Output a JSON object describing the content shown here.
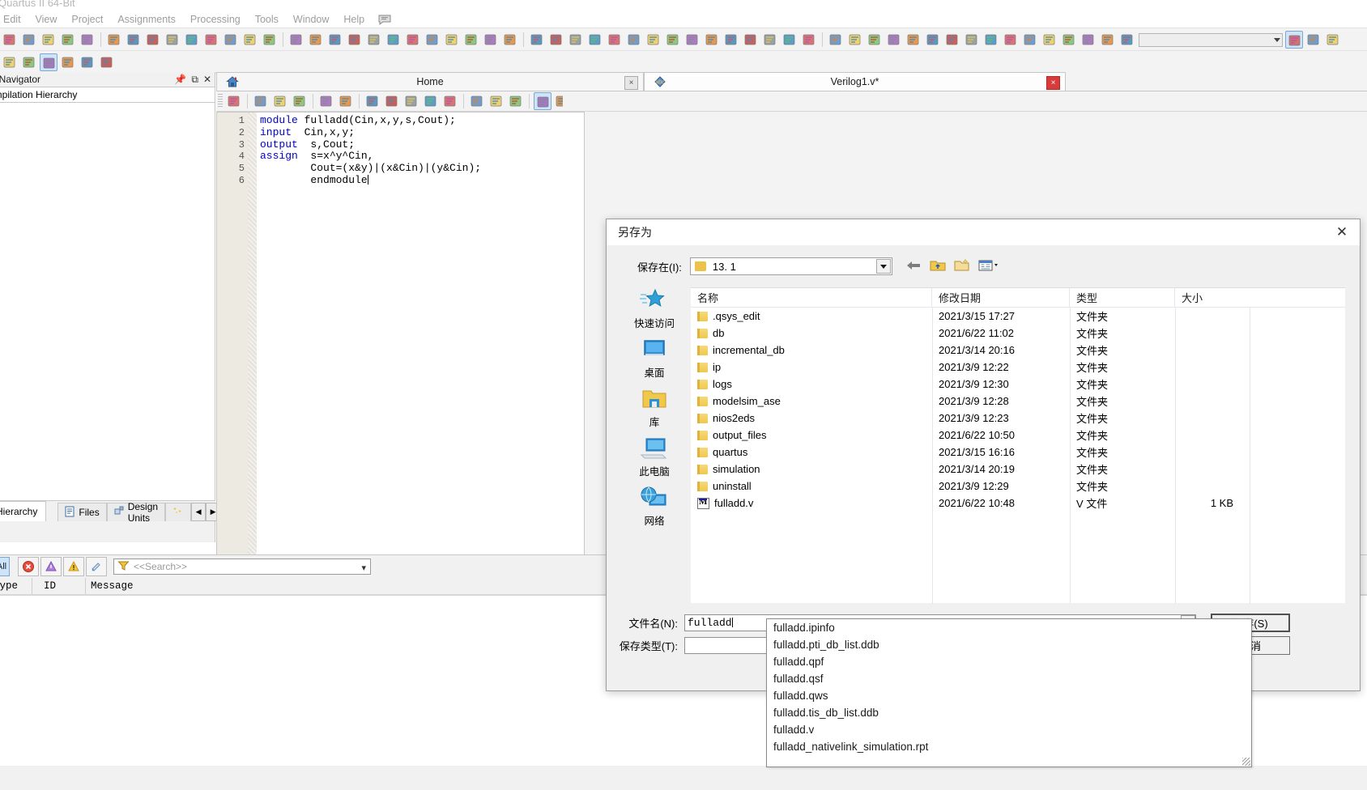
{
  "app": {
    "title": "Quartus II 64-Bit",
    "menu": [
      "Edit",
      "View",
      "Project",
      "Assignments",
      "Processing",
      "Tools",
      "Window",
      "Help"
    ],
    "menu_icon": "comment-balloon-icon"
  },
  "toolbar": {
    "combo_value": "",
    "combo_placeholder": ""
  },
  "navigator": {
    "title": "Project Navigator",
    "title_truncated": "ct Navigator",
    "subtitle": "Compilation Hierarchy",
    "subtitle_truncated": "ompilation Hierarchy",
    "pin_icon": "pin-icon",
    "restore_icon": "restore-icon",
    "close_icon": "close-icon",
    "tabs": [
      {
        "label": "Hierarchy",
        "label_truncated": "Hierarchy",
        "icon": "hierarchy-icon",
        "active": true
      },
      {
        "label": "Files",
        "icon": "files-icon",
        "active": false
      },
      {
        "label": "Design Units",
        "icon": "design-units-icon",
        "active": false
      },
      {
        "label": "",
        "icon": "ip-components-icon",
        "active": false
      }
    ],
    "scroll_left": "◀",
    "scroll_right": "▶"
  },
  "editor": {
    "tabs": [
      {
        "label": "Home",
        "icon": "home-icon",
        "close": "×",
        "active": false
      },
      {
        "label": "Verilog1.v*",
        "icon": "abc-diamond-icon",
        "close": "×",
        "active": true
      }
    ],
    "line_numbers": [
      "1",
      "2",
      "3",
      "4",
      "5",
      "6"
    ],
    "code_lines": [
      {
        "indent": 0,
        "keyword": "module",
        "rest": " fulladd(Cin,x,y,s,Cout);"
      },
      {
        "indent": 0,
        "keyword": "input",
        "rest": "  Cin,x,y;"
      },
      {
        "indent": 0,
        "keyword": "output",
        "rest": "  s,Cout;"
      },
      {
        "indent": 0,
        "keyword": "assign",
        "rest": "  s=x^y^Cin,"
      },
      {
        "indent": 8,
        "keyword": "",
        "rest": "Cout=(x&y)|(x&Cin)|(y&Cin);"
      },
      {
        "indent": 8,
        "keyword": "",
        "rest": "endmodule",
        "caret": true
      }
    ]
  },
  "messages": {
    "buttons": [
      {
        "label": "All",
        "name": "filter-all-button"
      },
      {
        "label": "",
        "name": "error-filter-button"
      },
      {
        "label": "",
        "name": "critical-warning-filter-button"
      },
      {
        "label": "",
        "name": "warning-filter-button"
      },
      {
        "label": "",
        "name": "info-filter-button"
      }
    ],
    "search_placeholder": "<<Search>>",
    "columns": [
      "Type",
      "ID",
      "Message"
    ],
    "rows": []
  },
  "dialog": {
    "title": "另存为",
    "close_label": "✕",
    "save_in_label": "保存在(I):",
    "current_folder": "13. 1",
    "nav_icons": [
      {
        "name": "back-arrow-icon",
        "glyph": "←"
      },
      {
        "name": "up-folder-icon",
        "glyph": ""
      },
      {
        "name": "new-folder-icon",
        "glyph": ""
      },
      {
        "name": "view-mode-icon",
        "glyph": ""
      }
    ],
    "places": [
      {
        "label": "快速访问",
        "icon": "quick-access-star-icon"
      },
      {
        "label": "桌面",
        "icon": "desktop-icon"
      },
      {
        "label": "库",
        "icon": "library-folder-icon"
      },
      {
        "label": "此电脑",
        "icon": "this-pc-icon"
      },
      {
        "label": "网络",
        "icon": "network-icon"
      }
    ],
    "columns": [
      "名称",
      "修改日期",
      "类型",
      "大小"
    ],
    "files": [
      {
        "name": ".qsys_edit",
        "date": "2021/3/15 17:27",
        "type": "文件夹",
        "size": "",
        "icon": "folder-icon"
      },
      {
        "name": "db",
        "date": "2021/6/22 11:02",
        "type": "文件夹",
        "size": "",
        "icon": "folder-icon"
      },
      {
        "name": "incremental_db",
        "date": "2021/3/14 20:16",
        "type": "文件夹",
        "size": "",
        "icon": "folder-icon"
      },
      {
        "name": "ip",
        "date": "2021/3/9 12:22",
        "type": "文件夹",
        "size": "",
        "icon": "folder-icon"
      },
      {
        "name": "logs",
        "date": "2021/3/9 12:30",
        "type": "文件夹",
        "size": "",
        "icon": "folder-icon"
      },
      {
        "name": "modelsim_ase",
        "date": "2021/3/9 12:28",
        "type": "文件夹",
        "size": "",
        "icon": "folder-icon"
      },
      {
        "name": "nios2eds",
        "date": "2021/3/9 12:23",
        "type": "文件夹",
        "size": "",
        "icon": "folder-icon"
      },
      {
        "name": "output_files",
        "date": "2021/6/22 10:50",
        "type": "文件夹",
        "size": "",
        "icon": "folder-icon"
      },
      {
        "name": "quartus",
        "date": "2021/3/15 16:16",
        "type": "文件夹",
        "size": "",
        "icon": "folder-icon"
      },
      {
        "name": "simulation",
        "date": "2021/3/14 20:19",
        "type": "文件夹",
        "size": "",
        "icon": "folder-icon"
      },
      {
        "name": "uninstall",
        "date": "2021/3/9 12:29",
        "type": "文件夹",
        "size": "",
        "icon": "folder-icon"
      },
      {
        "name": "fulladd.v",
        "date": "2021/6/22 10:48",
        "type": "V 文件",
        "size": "1 KB",
        "icon": "v-file-icon"
      }
    ],
    "filename_label": "文件名(N):",
    "filename_value": "fulladd",
    "filetype_label": "保存类型(T):",
    "filetype_value": "",
    "save_button": "保存(S)",
    "cancel_button": "取消",
    "autocomplete": [
      "fulladd.ipinfo",
      "fulladd.pti_db_list.ddb",
      "fulladd.qpf",
      "fulladd.qsf",
      "fulladd.qws",
      "fulladd.tis_db_list.ddb",
      "fulladd.v",
      "fulladd_nativelink_simulation.rpt"
    ]
  },
  "colors": {
    "keyword": "#0000c8",
    "accent": "#cfe4f7",
    "folder": "#f0c84c",
    "dialog_bg": "#f0f0f0"
  }
}
